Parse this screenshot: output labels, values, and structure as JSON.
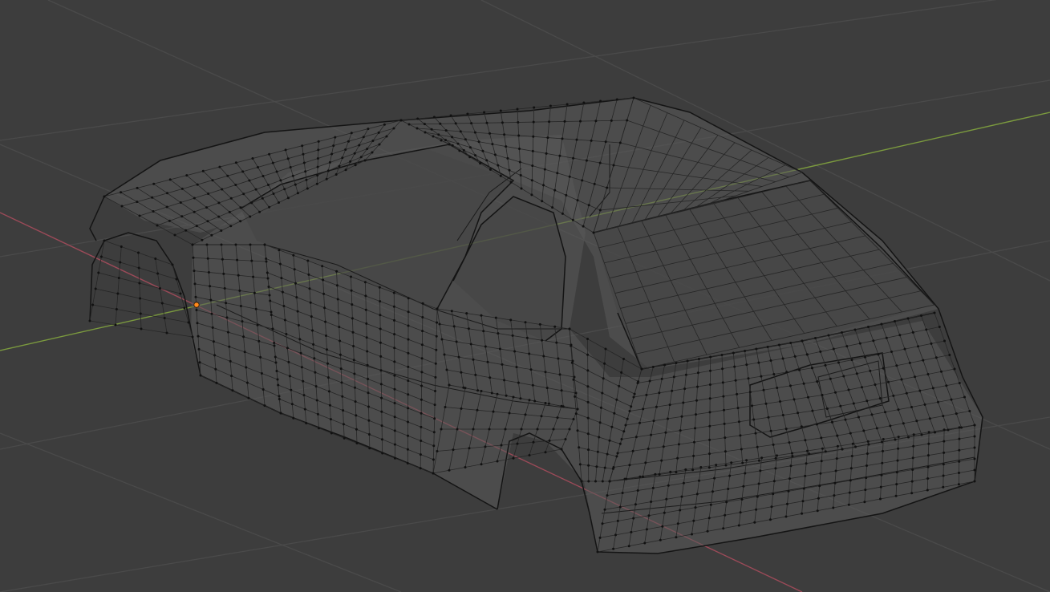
{
  "viewport": {
    "background_color": "#3d3d3d",
    "grid_color": "#4a4a4a",
    "x_axis_color": "#9b4a58",
    "y_axis_color": "#7b9a3e",
    "mesh_edge_color": "#1b1b1b",
    "mesh_face_color": "#5a5a5a",
    "selected_vertex_color": "#ff8a1c"
  },
  "scene": {
    "object": "car-body-mesh",
    "mode": "edit-mode-wireframe",
    "selected_vertices": 1
  }
}
